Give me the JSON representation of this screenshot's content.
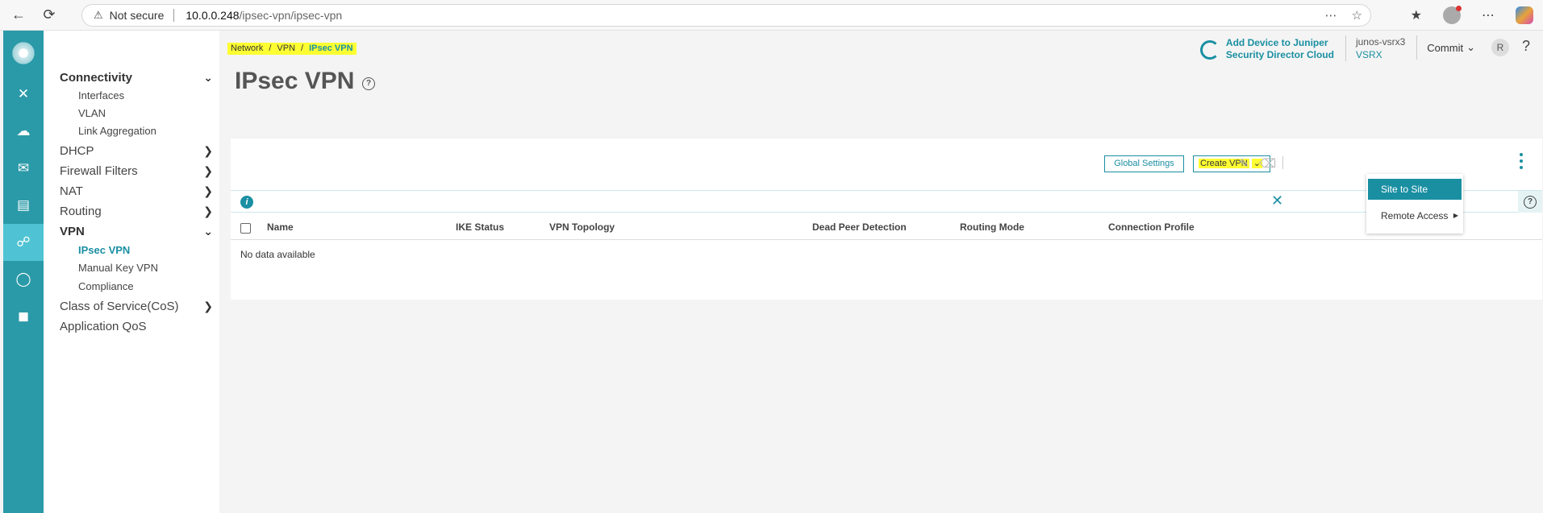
{
  "browser": {
    "security_label": "Not secure",
    "url_host": "10.0.0.248",
    "url_path": "/ipsec-vpn/ipsec-vpn"
  },
  "sidebar": {
    "groups": [
      {
        "label": "Connectivity",
        "expanded": true,
        "items": [
          "Interfaces",
          "VLAN",
          "Link Aggregation"
        ]
      },
      {
        "label": "DHCP",
        "expanded": false
      },
      {
        "label": "Firewall Filters",
        "expanded": false
      },
      {
        "label": "NAT",
        "expanded": false
      },
      {
        "label": "Routing",
        "expanded": false
      },
      {
        "label": "VPN",
        "expanded": true,
        "items": [
          "IPsec VPN",
          "Manual Key VPN",
          "Compliance"
        ],
        "active_item": "IPsec VPN"
      },
      {
        "label": "Class of Service(CoS)",
        "expanded": false
      },
      {
        "label": "Application QoS"
      }
    ]
  },
  "breadcrumb": [
    "Network",
    "/",
    "VPN",
    "/",
    "IPsec VPN"
  ],
  "page_title": "IPsec VPN",
  "header": {
    "jsd_line1": "Add Device to Juniper",
    "jsd_line2": "Security Director Cloud",
    "device_name": "junos-vsrx3",
    "device_model": "VSRX",
    "commit_label": "Commit",
    "avatar_initial": "R",
    "help": "?"
  },
  "toolbar": {
    "global_settings": "Global Settings",
    "create_vpn": "Create VPN"
  },
  "dropdown": {
    "items": [
      "Site to Site",
      "Remote Access"
    ]
  },
  "grid": {
    "columns": [
      "Name",
      "IKE Status",
      "VPN Topology",
      "Dead Peer Detection",
      "Routing Mode",
      "Connection Profile"
    ],
    "empty_text": "No data available"
  },
  "colors": {
    "accent": "#1a8fa2",
    "rail": "#2b9aa8",
    "highlight": "#fdff32"
  }
}
